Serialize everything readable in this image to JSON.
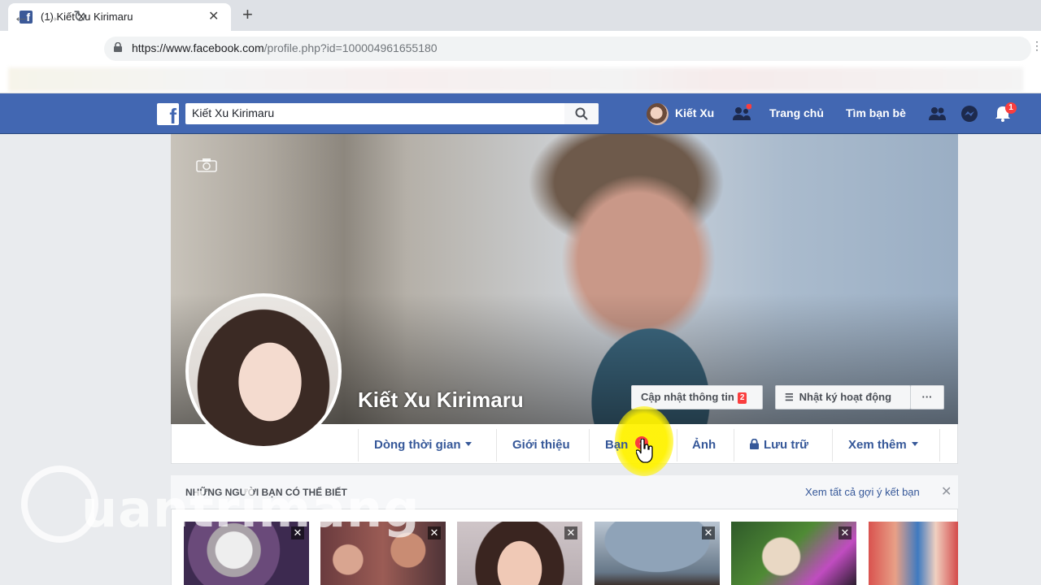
{
  "browser": {
    "tab_title": "(1) Kiết Xu Kirimaru",
    "url_host": "https://www.facebook.com",
    "url_path": "/profile.php?id=100004961655180"
  },
  "fb_header": {
    "search_value": "Kiết Xu Kirimaru",
    "user_name": "Kiết Xu",
    "home_label": "Trang chủ",
    "find_friends_label": "Tìm bạn bè",
    "notifications_count": "1"
  },
  "profile": {
    "name": "Kiết Xu Kirimaru",
    "update_info_label": "Cập nhật thông tin",
    "update_info_badge": "2",
    "activity_log_label": "Nhật ký hoạt động",
    "more_dots": "···"
  },
  "profile_nav": {
    "timeline": "Dòng thời gian",
    "about": "Giới thiệu",
    "friends": "Bạn",
    "friends_badge": "2",
    "photos": "Ảnh",
    "archive": "Lưu trữ",
    "more": "Xem thêm"
  },
  "pymk": {
    "title": "NHỮNG NGƯỜI BẠN CÓ THỂ BIẾT",
    "see_all": "Xem tất cả gợi ý kết bạn",
    "close": "✕",
    "card_close": "✕"
  },
  "watermark": {
    "text": "uantrimang"
  },
  "colors": {
    "fb_blue": "#4267b2",
    "link_blue": "#365899",
    "badge_red": "#fa3e3e",
    "cursor_highlight": "#fff200"
  }
}
